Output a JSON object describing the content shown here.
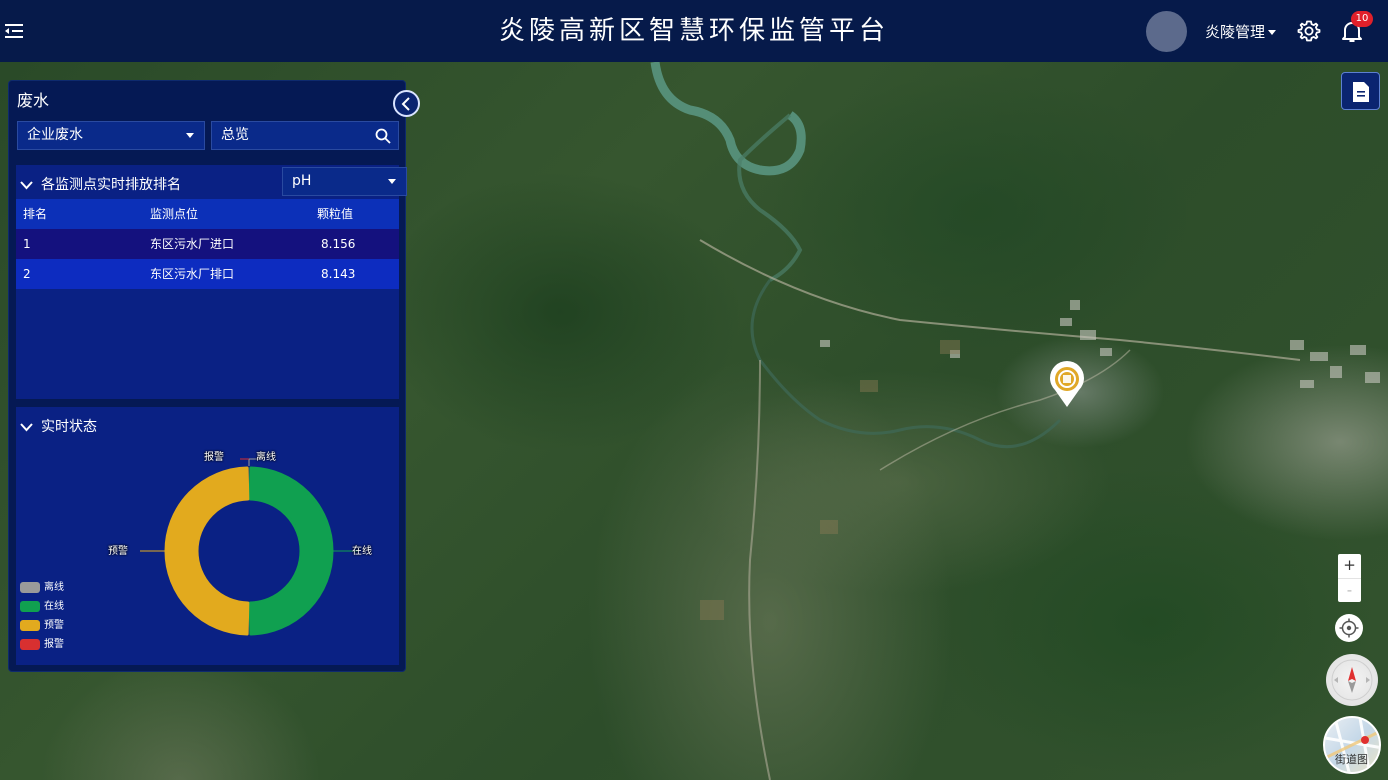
{
  "header": {
    "title": "炎陵高新区智慧环保监管平台",
    "user_name": "炎陵管理",
    "notification_count": "10"
  },
  "panel": {
    "title": "废水",
    "category_select": "企业废水",
    "search_value": "总览",
    "ranking": {
      "title": "各监测点实时排放排名",
      "metric_select": "pH",
      "columns": [
        "排名",
        "监测点位",
        "颗粒值"
      ],
      "rows": [
        {
          "rank": "1",
          "site": "东区污水厂进口",
          "value": "8.156"
        },
        {
          "rank": "2",
          "site": "东区污水厂排口",
          "value": "8.143"
        }
      ]
    },
    "status": {
      "title": "实时状态",
      "legend": [
        {
          "label": "离线",
          "color": "#9a9a9a"
        },
        {
          "label": "在线",
          "color": "#10a050"
        },
        {
          "label": "预警",
          "color": "#e2aa1e"
        },
        {
          "label": "报警",
          "color": "#d83030"
        }
      ],
      "slice_labels": {
        "offline": "离线",
        "alarm": "报警",
        "online": "在线",
        "warning": "预警"
      }
    }
  },
  "map_controls": {
    "zoom_in": "+",
    "zoom_out": "-",
    "street_view": "街道图"
  },
  "chart_data": {
    "type": "pie",
    "title": "实时状态",
    "categories": [
      "离线",
      "在线",
      "预警",
      "报警"
    ],
    "values": [
      0,
      1,
      1,
      0
    ],
    "colors": [
      "#9a9a9a",
      "#10a050",
      "#e2aa1e",
      "#d83030"
    ],
    "legend_position": "bottom-left"
  }
}
